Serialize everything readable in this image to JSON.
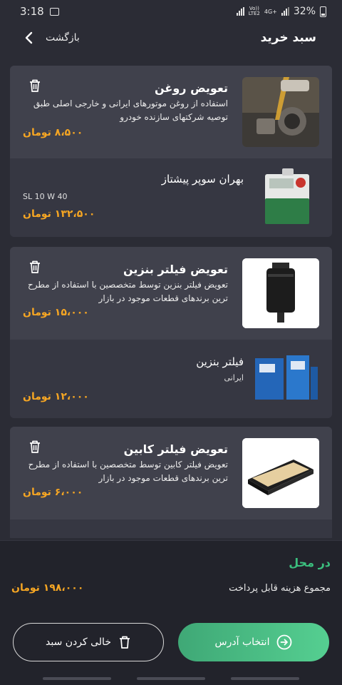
{
  "status_bar": {
    "time": "3:18",
    "network_top": "Vo))",
    "network_bottom": "LTE2",
    "network_type": "4G+",
    "battery": "32%"
  },
  "header": {
    "title": "سبد خرید",
    "back_label": "بازگشت"
  },
  "services": [
    {
      "title": "تعویض روغن",
      "description": "استفاده از روغن موتورهای ایرانی و خارجی اصلی طبق توصیه شرکتهای سازنده خودرو",
      "price": "۸،۵۰۰ تومان",
      "product": {
        "name": "بهران سوپر پیشتاز",
        "sub": "SL 10 W 40",
        "price": "۱۳۲،۵۰۰ تومان"
      }
    },
    {
      "title": "تعویض فیلتر بنزین",
      "description": "تعویض فیلتر بنزین توسط متخصصین با استفاده از مطرح ترین برندهای قطعات موجود در بازار",
      "price": "۱۵،۰۰۰ تومان",
      "product": {
        "name": "فیلتر بنزین",
        "sub": "ایرانی",
        "price": "۱۲،۰۰۰ تومان"
      }
    },
    {
      "title": "تعویض فیلتر کابین",
      "description": "تعویض فیلتر کابین توسط متخصصین با استفاده از مطرح ترین برندهای قطعات موجود در بازار",
      "price": "۶،۰۰۰ تومان"
    }
  ],
  "footer": {
    "location": "در محل",
    "total_label": "مجموع هزینه قابل پرداخت",
    "total_amount": "۱۹۸،۰۰۰ تومان",
    "address_button": "انتخاب آدرس",
    "clear_button": "خالی کردن سبد"
  },
  "colors": {
    "background": "#2b2c35",
    "card": "#40414c",
    "price": "#f6a623",
    "accent_green": "#3bbf7e"
  }
}
